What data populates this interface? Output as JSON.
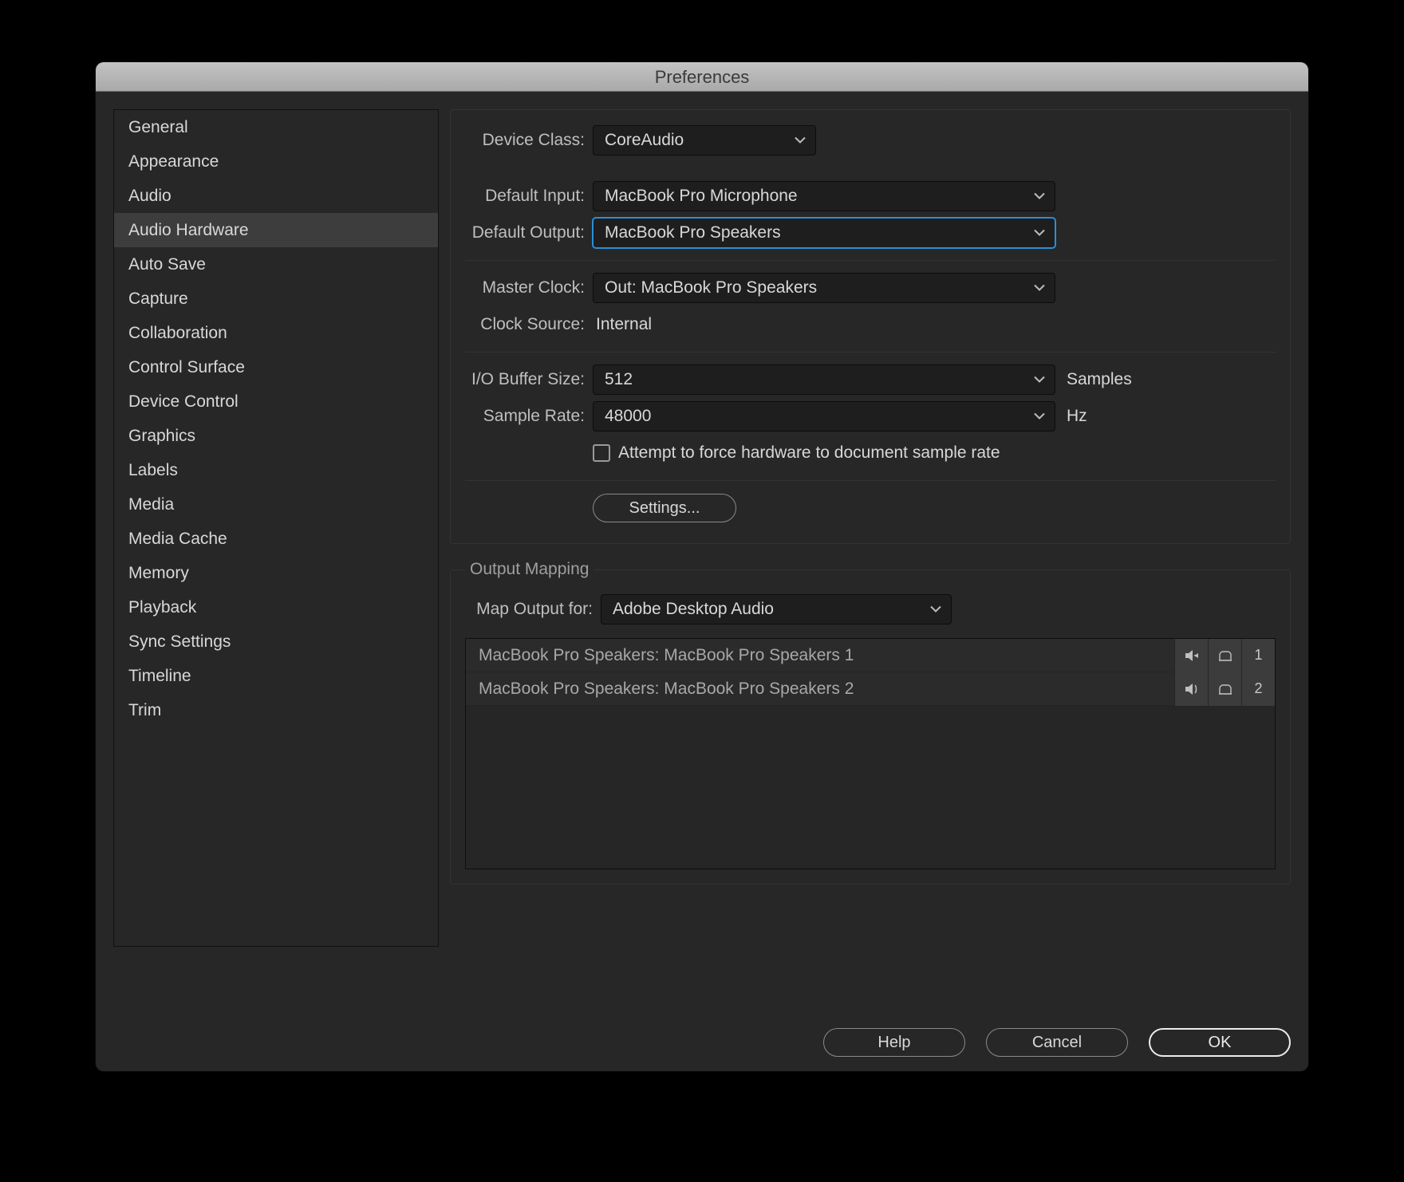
{
  "title": "Preferences",
  "sidebar": {
    "items": [
      {
        "label": "General"
      },
      {
        "label": "Appearance"
      },
      {
        "label": "Audio"
      },
      {
        "label": "Audio Hardware",
        "selected": true
      },
      {
        "label": "Auto Save"
      },
      {
        "label": "Capture"
      },
      {
        "label": "Collaboration"
      },
      {
        "label": "Control Surface"
      },
      {
        "label": "Device Control"
      },
      {
        "label": "Graphics"
      },
      {
        "label": "Labels"
      },
      {
        "label": "Media"
      },
      {
        "label": "Media Cache"
      },
      {
        "label": "Memory"
      },
      {
        "label": "Playback"
      },
      {
        "label": "Sync Settings"
      },
      {
        "label": "Timeline"
      },
      {
        "label": "Trim"
      }
    ]
  },
  "fields": {
    "device_class": {
      "label": "Device Class:",
      "value": "CoreAudio"
    },
    "default_input": {
      "label": "Default Input:",
      "value": "MacBook Pro Microphone"
    },
    "default_output": {
      "label": "Default Output:",
      "value": "MacBook Pro Speakers"
    },
    "master_clock": {
      "label": "Master Clock:",
      "value": "Out: MacBook Pro Speakers"
    },
    "clock_source": {
      "label": "Clock Source:",
      "value": "Internal"
    },
    "io_buffer": {
      "label": "I/O Buffer Size:",
      "value": "512",
      "unit": "Samples"
    },
    "sample_rate": {
      "label": "Sample Rate:",
      "value": "48000",
      "unit": "Hz"
    },
    "force_checkbox": {
      "label": "Attempt to force hardware to document sample rate",
      "checked": false
    },
    "settings_btn": "Settings..."
  },
  "output_mapping": {
    "legend": "Output Mapping",
    "map_for": {
      "label": "Map Output for:",
      "value": "Adobe Desktop Audio"
    },
    "rows": [
      {
        "label": "MacBook Pro Speakers: MacBook Pro Speakers 1",
        "num": "1"
      },
      {
        "label": "MacBook Pro Speakers: MacBook Pro Speakers 2",
        "num": "2"
      }
    ]
  },
  "buttons": {
    "help": "Help",
    "cancel": "Cancel",
    "ok": "OK"
  }
}
